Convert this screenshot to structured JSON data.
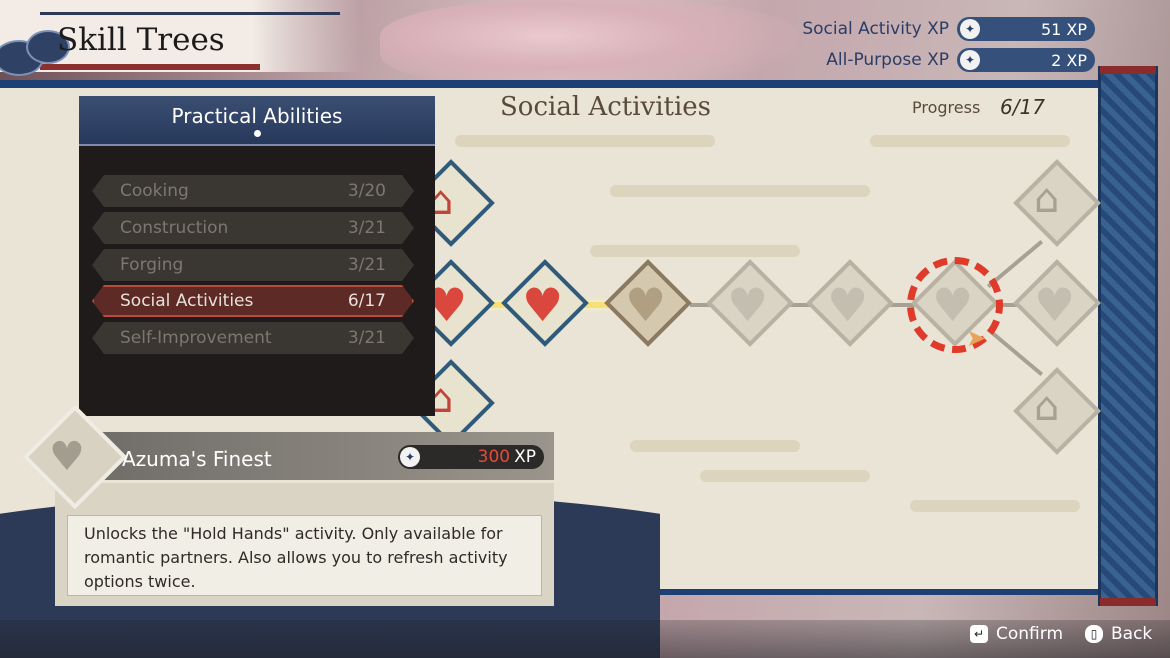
{
  "header": {
    "title": "Skill Trees",
    "xp": [
      {
        "label": "Social Activity XP",
        "value": "51",
        "unit": "XP"
      },
      {
        "label": "All-Purpose XP",
        "value": "2",
        "unit": "XP"
      }
    ]
  },
  "board": {
    "title": "Social Activities",
    "progress_label": "Progress",
    "progress_value": "6/17"
  },
  "categories": {
    "title": "Practical Abilities",
    "items": [
      {
        "label": "Cooking",
        "progress": "3/20"
      },
      {
        "label": "Construction",
        "progress": "3/21"
      },
      {
        "label": "Forging",
        "progress": "3/21"
      },
      {
        "label": "Social Activities",
        "progress": "6/17",
        "active": true
      },
      {
        "label": "Self-Improvement",
        "progress": "3/21"
      }
    ]
  },
  "skill": {
    "name": "Azuma's Finest",
    "cost_value": "300",
    "cost_unit": "XP",
    "description": "Unlocks the \"Hold Hands\" activity. Only available for romantic partners. Also allows you to refresh activity options twice."
  },
  "footer": {
    "confirm": "Confirm",
    "back": "Back"
  },
  "icons": {
    "xp_icon": "spark-icon",
    "skill_icon": "heart-icon",
    "house_icon": "house-icon",
    "confirm_icon": "enter-key-icon",
    "back_icon": "mouse-icon"
  },
  "colors": {
    "accent_blue": "#2b3d66",
    "accent_red": "#e03a2b",
    "cost_red": "#e64a3c"
  }
}
